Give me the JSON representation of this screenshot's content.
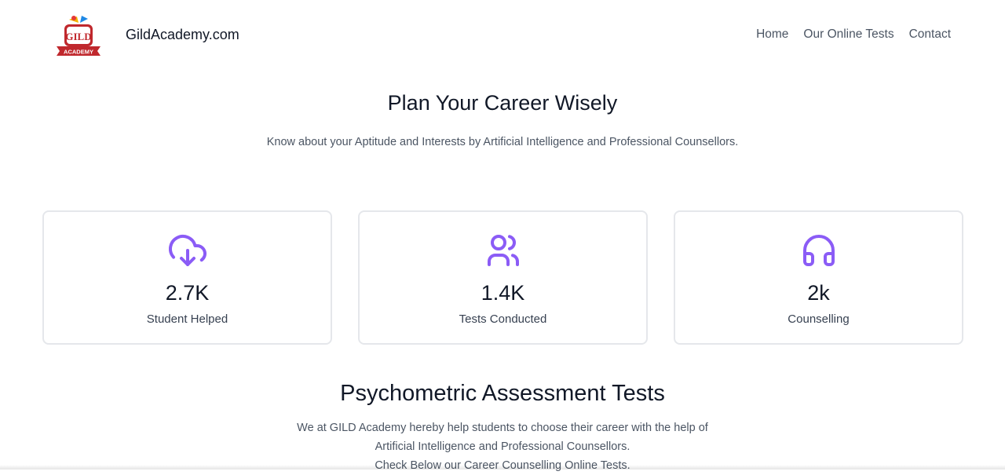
{
  "header": {
    "logo_text": {
      "top": "GILD",
      "ribbon": "ACADEMY"
    },
    "brand": "GildAcademy.com",
    "nav": [
      "Home",
      "Our Online Tests",
      "Contact"
    ]
  },
  "hero": {
    "title": "Plan Your Career Wisely",
    "subtitle": "Know about your Aptitude and Interests by Artificial Intelligence and Professional Counsellors."
  },
  "stats": [
    {
      "icon": "cloud-download-icon",
      "value": "2.7K",
      "label": "Student Helped"
    },
    {
      "icon": "users-icon",
      "value": "1.4K",
      "label": "Tests Conducted"
    },
    {
      "icon": "headphones-icon",
      "value": "2k",
      "label": "Counselling"
    }
  ],
  "section": {
    "title": "Psychometric Assessment Tests",
    "lines": [
      "We at GILD Academy hereby help students to choose their career with the help of",
      "Artificial Intelligence and Professional Counsellors.",
      "Check Below our Career Counselling Online Tests."
    ]
  },
  "colors": {
    "accent": "#8b5cf6",
    "logo_red": "#c0282d",
    "logo_gold": "#f4b400"
  }
}
